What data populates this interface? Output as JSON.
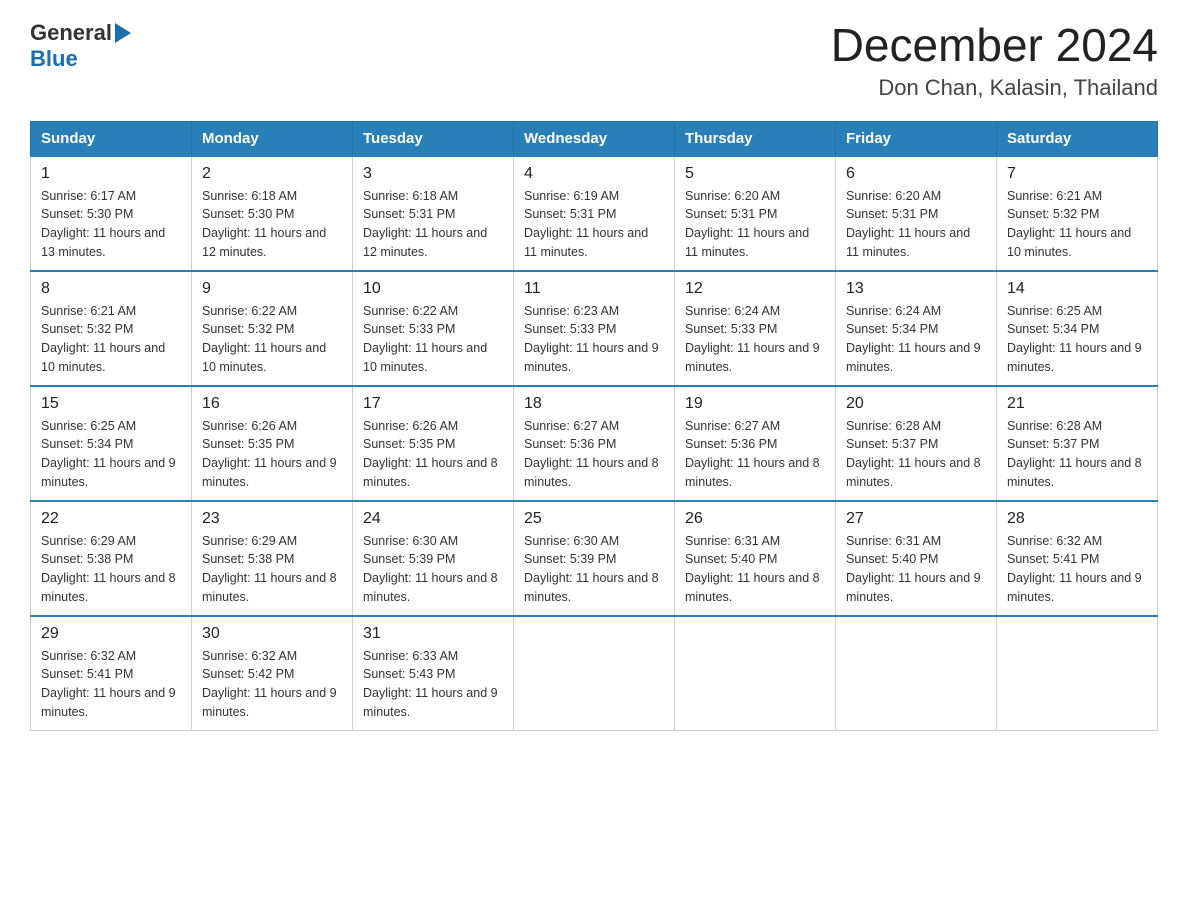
{
  "header": {
    "logo_general": "General",
    "logo_blue": "Blue",
    "month_title": "December 2024",
    "location": "Don Chan, Kalasin, Thailand"
  },
  "days_of_week": [
    "Sunday",
    "Monday",
    "Tuesday",
    "Wednesday",
    "Thursday",
    "Friday",
    "Saturday"
  ],
  "weeks": [
    [
      {
        "day": "1",
        "sunrise": "6:17 AM",
        "sunset": "5:30 PM",
        "daylight": "11 hours and 13 minutes."
      },
      {
        "day": "2",
        "sunrise": "6:18 AM",
        "sunset": "5:30 PM",
        "daylight": "11 hours and 12 minutes."
      },
      {
        "day": "3",
        "sunrise": "6:18 AM",
        "sunset": "5:31 PM",
        "daylight": "11 hours and 12 minutes."
      },
      {
        "day": "4",
        "sunrise": "6:19 AM",
        "sunset": "5:31 PM",
        "daylight": "11 hours and 11 minutes."
      },
      {
        "day": "5",
        "sunrise": "6:20 AM",
        "sunset": "5:31 PM",
        "daylight": "11 hours and 11 minutes."
      },
      {
        "day": "6",
        "sunrise": "6:20 AM",
        "sunset": "5:31 PM",
        "daylight": "11 hours and 11 minutes."
      },
      {
        "day": "7",
        "sunrise": "6:21 AM",
        "sunset": "5:32 PM",
        "daylight": "11 hours and 10 minutes."
      }
    ],
    [
      {
        "day": "8",
        "sunrise": "6:21 AM",
        "sunset": "5:32 PM",
        "daylight": "11 hours and 10 minutes."
      },
      {
        "day": "9",
        "sunrise": "6:22 AM",
        "sunset": "5:32 PM",
        "daylight": "11 hours and 10 minutes."
      },
      {
        "day": "10",
        "sunrise": "6:22 AM",
        "sunset": "5:33 PM",
        "daylight": "11 hours and 10 minutes."
      },
      {
        "day": "11",
        "sunrise": "6:23 AM",
        "sunset": "5:33 PM",
        "daylight": "11 hours and 9 minutes."
      },
      {
        "day": "12",
        "sunrise": "6:24 AM",
        "sunset": "5:33 PM",
        "daylight": "11 hours and 9 minutes."
      },
      {
        "day": "13",
        "sunrise": "6:24 AM",
        "sunset": "5:34 PM",
        "daylight": "11 hours and 9 minutes."
      },
      {
        "day": "14",
        "sunrise": "6:25 AM",
        "sunset": "5:34 PM",
        "daylight": "11 hours and 9 minutes."
      }
    ],
    [
      {
        "day": "15",
        "sunrise": "6:25 AM",
        "sunset": "5:34 PM",
        "daylight": "11 hours and 9 minutes."
      },
      {
        "day": "16",
        "sunrise": "6:26 AM",
        "sunset": "5:35 PM",
        "daylight": "11 hours and 9 minutes."
      },
      {
        "day": "17",
        "sunrise": "6:26 AM",
        "sunset": "5:35 PM",
        "daylight": "11 hours and 8 minutes."
      },
      {
        "day": "18",
        "sunrise": "6:27 AM",
        "sunset": "5:36 PM",
        "daylight": "11 hours and 8 minutes."
      },
      {
        "day": "19",
        "sunrise": "6:27 AM",
        "sunset": "5:36 PM",
        "daylight": "11 hours and 8 minutes."
      },
      {
        "day": "20",
        "sunrise": "6:28 AM",
        "sunset": "5:37 PM",
        "daylight": "11 hours and 8 minutes."
      },
      {
        "day": "21",
        "sunrise": "6:28 AM",
        "sunset": "5:37 PM",
        "daylight": "11 hours and 8 minutes."
      }
    ],
    [
      {
        "day": "22",
        "sunrise": "6:29 AM",
        "sunset": "5:38 PM",
        "daylight": "11 hours and 8 minutes."
      },
      {
        "day": "23",
        "sunrise": "6:29 AM",
        "sunset": "5:38 PM",
        "daylight": "11 hours and 8 minutes."
      },
      {
        "day": "24",
        "sunrise": "6:30 AM",
        "sunset": "5:39 PM",
        "daylight": "11 hours and 8 minutes."
      },
      {
        "day": "25",
        "sunrise": "6:30 AM",
        "sunset": "5:39 PM",
        "daylight": "11 hours and 8 minutes."
      },
      {
        "day": "26",
        "sunrise": "6:31 AM",
        "sunset": "5:40 PM",
        "daylight": "11 hours and 8 minutes."
      },
      {
        "day": "27",
        "sunrise": "6:31 AM",
        "sunset": "5:40 PM",
        "daylight": "11 hours and 9 minutes."
      },
      {
        "day": "28",
        "sunrise": "6:32 AM",
        "sunset": "5:41 PM",
        "daylight": "11 hours and 9 minutes."
      }
    ],
    [
      {
        "day": "29",
        "sunrise": "6:32 AM",
        "sunset": "5:41 PM",
        "daylight": "11 hours and 9 minutes."
      },
      {
        "day": "30",
        "sunrise": "6:32 AM",
        "sunset": "5:42 PM",
        "daylight": "11 hours and 9 minutes."
      },
      {
        "day": "31",
        "sunrise": "6:33 AM",
        "sunset": "5:43 PM",
        "daylight": "11 hours and 9 minutes."
      },
      null,
      null,
      null,
      null
    ]
  ]
}
